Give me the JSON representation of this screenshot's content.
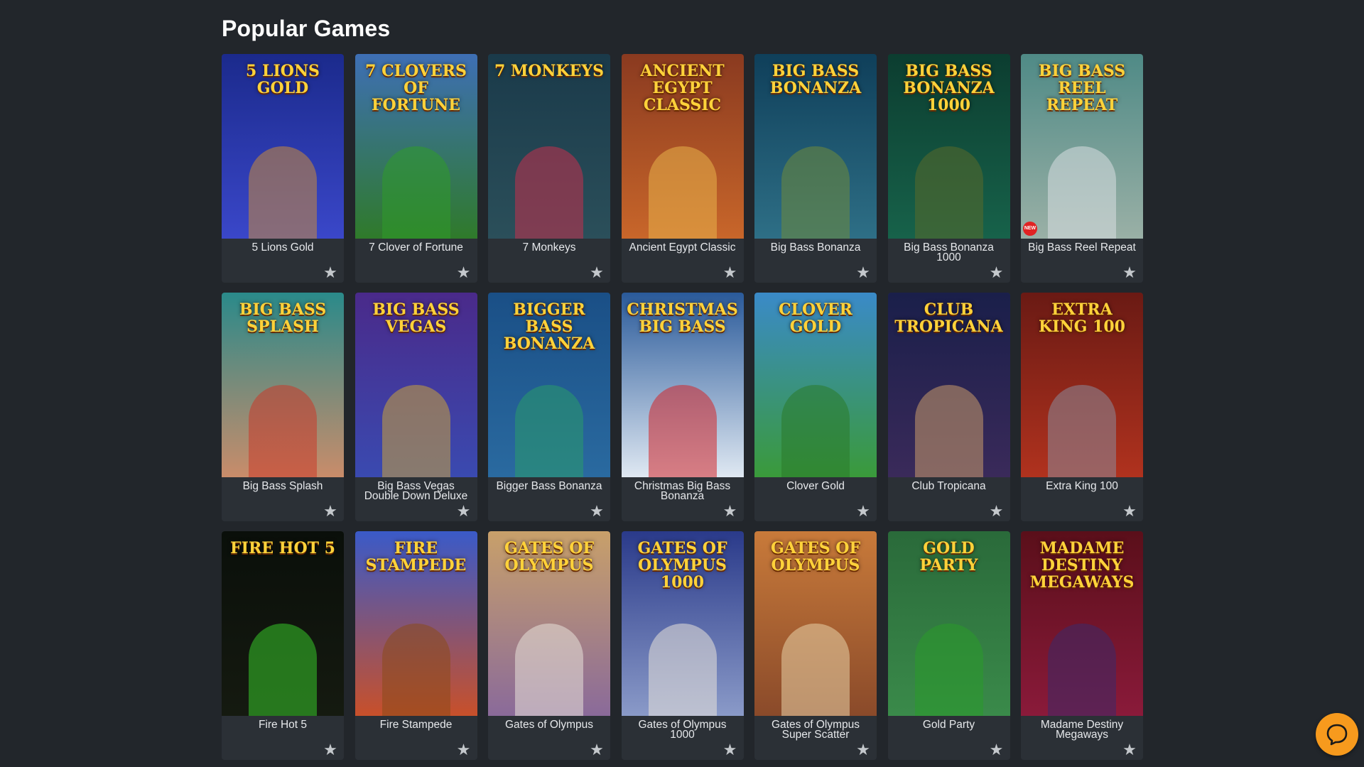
{
  "section": {
    "title": "Popular Games"
  },
  "games": [
    {
      "name": "5 Lions Gold",
      "logo": "5 Lions Gold",
      "bg": "#1b2a8c",
      "bg2": "#3a47c9",
      "figure": "#c88a3a"
    },
    {
      "name": "7 Clover of Fortune",
      "logo": "7 Clovers of Fortune",
      "bg": "#3e6fb5",
      "bg2": "#2f7a2a",
      "figure": "#2f9a2a"
    },
    {
      "name": "7 Monkeys",
      "logo": "7 Monkeys",
      "bg": "#1a3a4a",
      "bg2": "#2b4f5a",
      "figure": "#c4304c"
    },
    {
      "name": "Ancient Egypt Classic",
      "logo": "Ancient Egypt Classic",
      "bg": "#8a3a20",
      "bg2": "#c8662a",
      "figure": "#e8b24a"
    },
    {
      "name": "Big Bass Bonanza",
      "logo": "Big Bass Bonanza",
      "bg": "#0f3f5a",
      "bg2": "#2e6f86",
      "figure": "#6f8a3a"
    },
    {
      "name": "Big Bass Bonanza 1000",
      "logo": "Big Bass Bonanza 1000",
      "bg": "#0c3d30",
      "bg2": "#17624a",
      "figure": "#5a6a2a"
    },
    {
      "name": "Big Bass Reel Repeat",
      "logo": "Big Bass Reel Repeat",
      "bg": "#4f8a86",
      "bg2": "#9ab0a6",
      "figure": "#d9dfe1",
      "badge": "NEW"
    },
    {
      "name": "Big Bass Splash",
      "logo": "Big Bass Splash",
      "bg": "#2a8a8a",
      "bg2": "#c98c6a",
      "figure": "#c83a2a"
    },
    {
      "name": "Big Bass Vegas Double Down Deluxe",
      "logo": "Big Bass Vegas",
      "bg": "#4a2a8a",
      "bg2": "#3a4ab0",
      "figure": "#c8a23a"
    },
    {
      "name": "Bigger Bass Bonanza",
      "logo": "Bigger Bass Bonanza",
      "bg": "#1a4f86",
      "bg2": "#2a6aa0",
      "figure": "#2a9a6a"
    },
    {
      "name": "Christmas Big Bass Bonanza",
      "logo": "Christmas Big Bass",
      "bg": "#2a5a9a",
      "bg2": "#dfe8f2",
      "figure": "#d2262a"
    },
    {
      "name": "Clover Gold",
      "logo": "Clover Gold",
      "bg": "#3a8ac8",
      "bg2": "#3a9a3a",
      "figure": "#2a7a2a"
    },
    {
      "name": "Club Tropicana",
      "logo": "Club Tropicana",
      "bg": "#1a1f4a",
      "bg2": "#3a2a5a",
      "figure": "#c89a6a"
    },
    {
      "name": "Extra King 100",
      "logo": "Extra King 100",
      "bg": "#6a1a14",
      "bg2": "#b0321e",
      "figure": "#8a8a9a"
    },
    {
      "name": "Fire Hot 5",
      "logo": "Fire Hot 5",
      "bg": "#0a0f0a",
      "bg2": "#151a10",
      "figure": "#37c62a"
    },
    {
      "name": "Fire Stampede",
      "logo": "Fire Stampede",
      "bg": "#3a5ac8",
      "bg2": "#c8502a",
      "figure": "#8a4a1a"
    },
    {
      "name": "Gates of Olympus",
      "logo": "Gates of Olympus",
      "bg": "#c8a06a",
      "bg2": "#8a6a9a",
      "figure": "#e8e2d8"
    },
    {
      "name": "Gates of Olympus 1000",
      "logo": "Gates of Olympus 1000",
      "bg": "#2a3a8a",
      "bg2": "#8a9ac8",
      "figure": "#e8e2d8"
    },
    {
      "name": "Gates of Olympus Super Scatter",
      "logo": "Gates of Olympus",
      "bg": "#c87a3a",
      "bg2": "#8a4a2a",
      "figure": "#e8d2a8"
    },
    {
      "name": "Gold Party",
      "logo": "Gold Party",
      "bg": "#2a6a3a",
      "bg2": "#3a8a4a",
      "figure": "#2a9a2a"
    },
    {
      "name": "Madame Destiny Megaways",
      "logo": "Madame Destiny Megaways",
      "bg": "#5a0f1a",
      "bg2": "#8a1a3a",
      "figure": "#3a2a6a"
    }
  ],
  "icons": {
    "favorite": "star-icon",
    "chat": "chat-bubble-icon"
  },
  "colors": {
    "background": "#22262b",
    "card": "#2b3036",
    "chat": "#f79a1d"
  }
}
